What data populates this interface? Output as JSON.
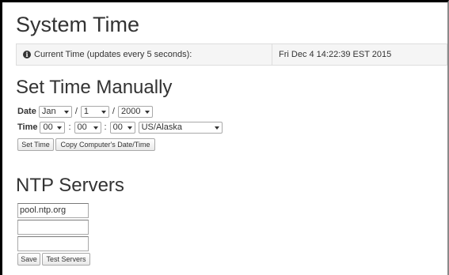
{
  "system_time": {
    "title": "System Time",
    "label": "Current Time (updates every 5 seconds):",
    "value": "Fri Dec 4 14:22:39 EST 2015"
  },
  "manual": {
    "title": "Set Time Manually",
    "date_label": "Date",
    "month": "Jan",
    "day": "1",
    "year": "2000",
    "date_sep": "/",
    "time_label": "Time",
    "hour": "00",
    "minute": "00",
    "second": "00",
    "time_sep": ":",
    "timezone": "US/Alaska",
    "set_time_button": "Set Time",
    "copy_button": "Copy Computer's Date/Time"
  },
  "ntp": {
    "title": "NTP Servers",
    "servers": [
      "pool.ntp.org",
      "",
      ""
    ],
    "save_button": "Save",
    "test_button": "Test Servers"
  },
  "icons": {
    "info": "info-circle-icon",
    "dropdown": "caret-down-icon"
  }
}
